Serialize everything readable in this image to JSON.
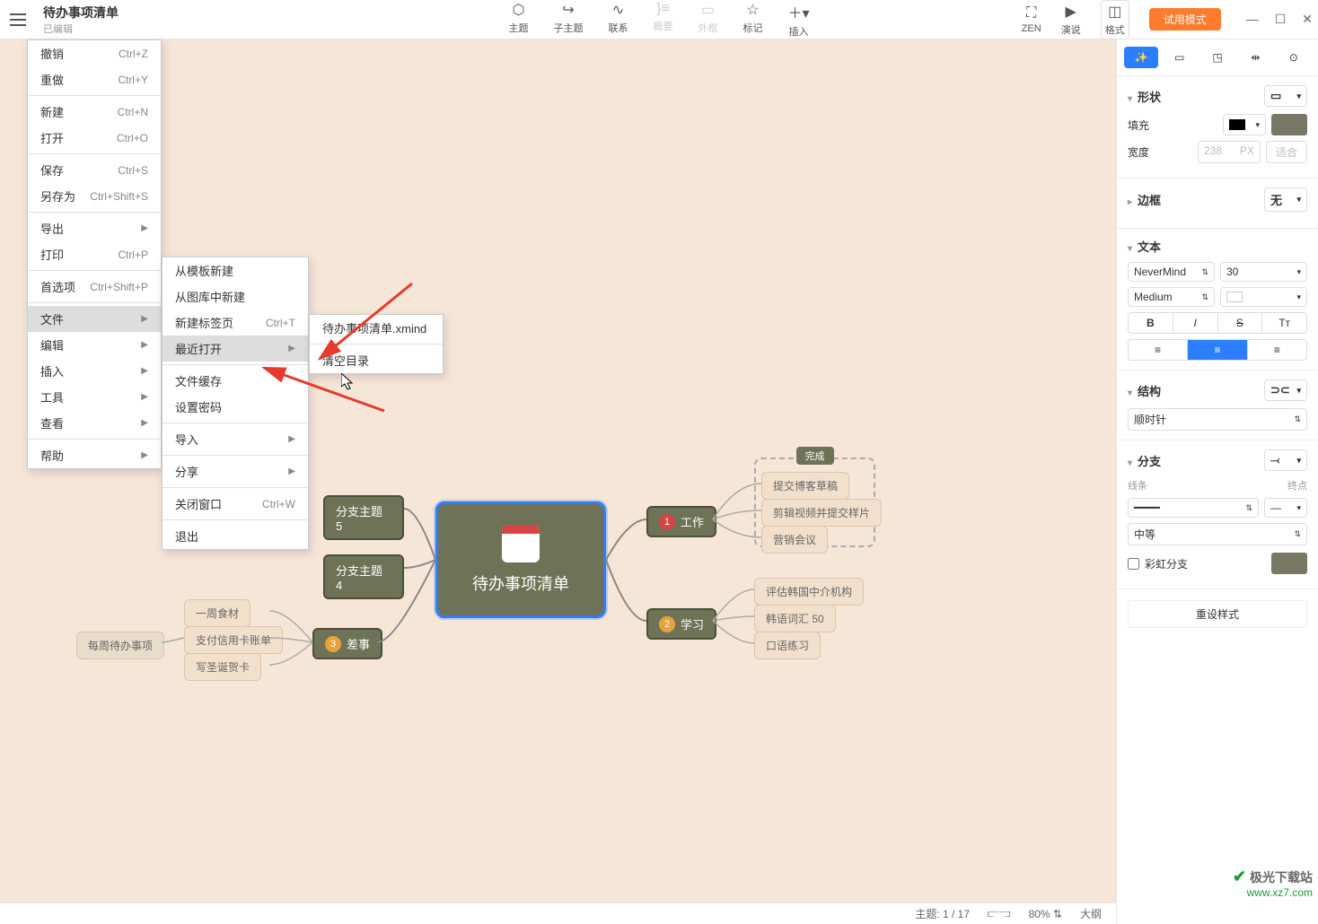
{
  "header": {
    "title": "待办事项清单",
    "subtitle": "已编辑",
    "toolbar": {
      "theme": "主题",
      "subtheme": "子主题",
      "relation": "联系",
      "summary": "概要",
      "boundary": "外框",
      "marker": "标记",
      "insert": "插入",
      "zen": "ZEN",
      "pitch": "演说",
      "format": "格式"
    },
    "trial": "试用模式"
  },
  "menu1": {
    "undo": "撤销",
    "undo_sc": "Ctrl+Z",
    "redo": "重做",
    "redo_sc": "Ctrl+Y",
    "new": "新建",
    "new_sc": "Ctrl+N",
    "open": "打开",
    "open_sc": "Ctrl+O",
    "save": "保存",
    "save_sc": "Ctrl+S",
    "saveas": "另存为",
    "saveas_sc": "Ctrl+Shift+S",
    "export": "导出",
    "print": "打印",
    "print_sc": "Ctrl+P",
    "pref": "首选项",
    "pref_sc": "Ctrl+Shift+P",
    "file": "文件",
    "edit": "编辑",
    "insert": "插入",
    "tool": "工具",
    "view": "查看",
    "help": "帮助"
  },
  "menu2": {
    "fromtpl": "从模板新建",
    "fromlib": "从图库中新建",
    "newtab": "新建标签页",
    "newtab_sc": "Ctrl+T",
    "recent": "最近打开",
    "cache": "文件缓存",
    "setpw": "设置密码",
    "import": "导入",
    "share": "分享",
    "closewin": "关闭窗口",
    "closewin_sc": "Ctrl+W",
    "exit": "退出"
  },
  "menu3": {
    "recentfile": "待办事项清单.xmind",
    "clear": "清空目录"
  },
  "mindmap": {
    "central": "待办事项清单",
    "work": "工作",
    "study": "学习",
    "errand": "差事",
    "sub5": "分支主题 5",
    "sub4": "分支主题 4",
    "weekly": "每周待办事项",
    "done_group": "完成",
    "work_items": [
      "提交博客草稿",
      "剪辑视频并提交样片",
      "营销会议"
    ],
    "study_items": [
      "评估韩国中介机构",
      "韩语词汇 50",
      "口语练习"
    ],
    "errand_items": [
      "一周食材",
      "支付信用卡账单",
      "写圣诞贺卡"
    ]
  },
  "sidebar": {
    "shape": "形状",
    "fill": "填充",
    "width": "宽度",
    "width_val": "238",
    "width_unit": "PX",
    "fit": "适合",
    "border": "边框",
    "border_val": "无",
    "text": "文本",
    "font": "NeverMind",
    "fontsize": "30",
    "weight": "Medium",
    "structure": "结构",
    "clockwise": "顺时针",
    "branch": "分支",
    "line": "线条",
    "endpoint": "终点",
    "medium": "中等",
    "rainbow": "彩虹分支",
    "reset": "重设样式"
  },
  "statusbar": {
    "topic": "主题: 1 / 17",
    "zoom": "80%",
    "outline": "大纲"
  },
  "watermark": {
    "l1": "极光下载站",
    "l2": "www.xz7.com"
  }
}
